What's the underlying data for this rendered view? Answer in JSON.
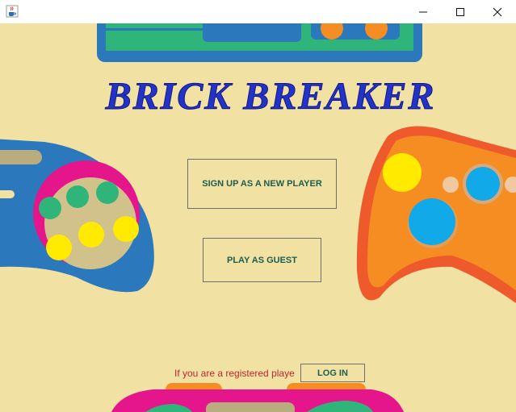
{
  "window": {
    "app_icon": "java-cup-icon",
    "controls": {
      "minimize": "minimize-icon",
      "maximize": "maximize-icon",
      "close": "close-icon"
    }
  },
  "game": {
    "title": "BRICK BREAKER"
  },
  "menu": {
    "signup_label": "SIGN UP AS A NEW PLAYER",
    "guest_label": "PLAY AS GUEST",
    "login_prompt": "If you are a registered playe",
    "login_label": "LOG IN"
  },
  "colors": {
    "background": "#f1e2a3",
    "title": "#2233c6",
    "button_text": "#1d5c52",
    "prompt_text": "#c0262f",
    "blue_controller": "#2b78bd",
    "orange_controller": "#f58d22",
    "magenta_controller": "#e5158b"
  }
}
